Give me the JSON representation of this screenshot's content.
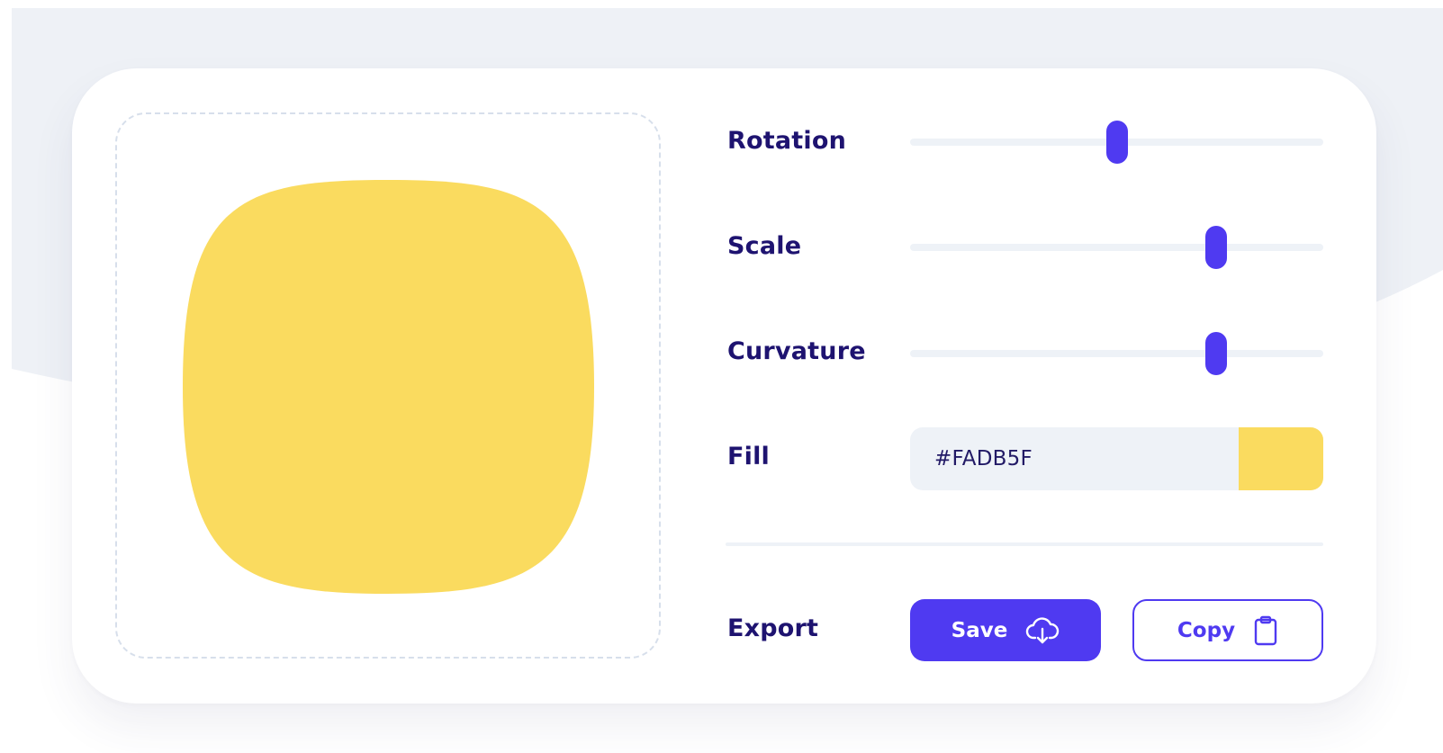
{
  "colors": {
    "accent": "#4F3AF1",
    "label": "#1E1370",
    "track": "#EEF2F7",
    "background": "#EEF1F6"
  },
  "preview": {
    "shape_fill": "#FADB5F"
  },
  "controls": {
    "rotation": {
      "label": "Rotation",
      "value_fraction": 0.5
    },
    "scale": {
      "label": "Scale",
      "value_fraction": 0.74
    },
    "curvature": {
      "label": "Curvature",
      "value_fraction": 0.74
    },
    "fill": {
      "label": "Fill",
      "value": "#FADB5F",
      "swatch_color": "#FADB5F"
    }
  },
  "export": {
    "label": "Export",
    "save_label": "Save",
    "save_icon": "cloud-download-icon",
    "copy_label": "Copy",
    "copy_icon": "clipboard-icon"
  }
}
